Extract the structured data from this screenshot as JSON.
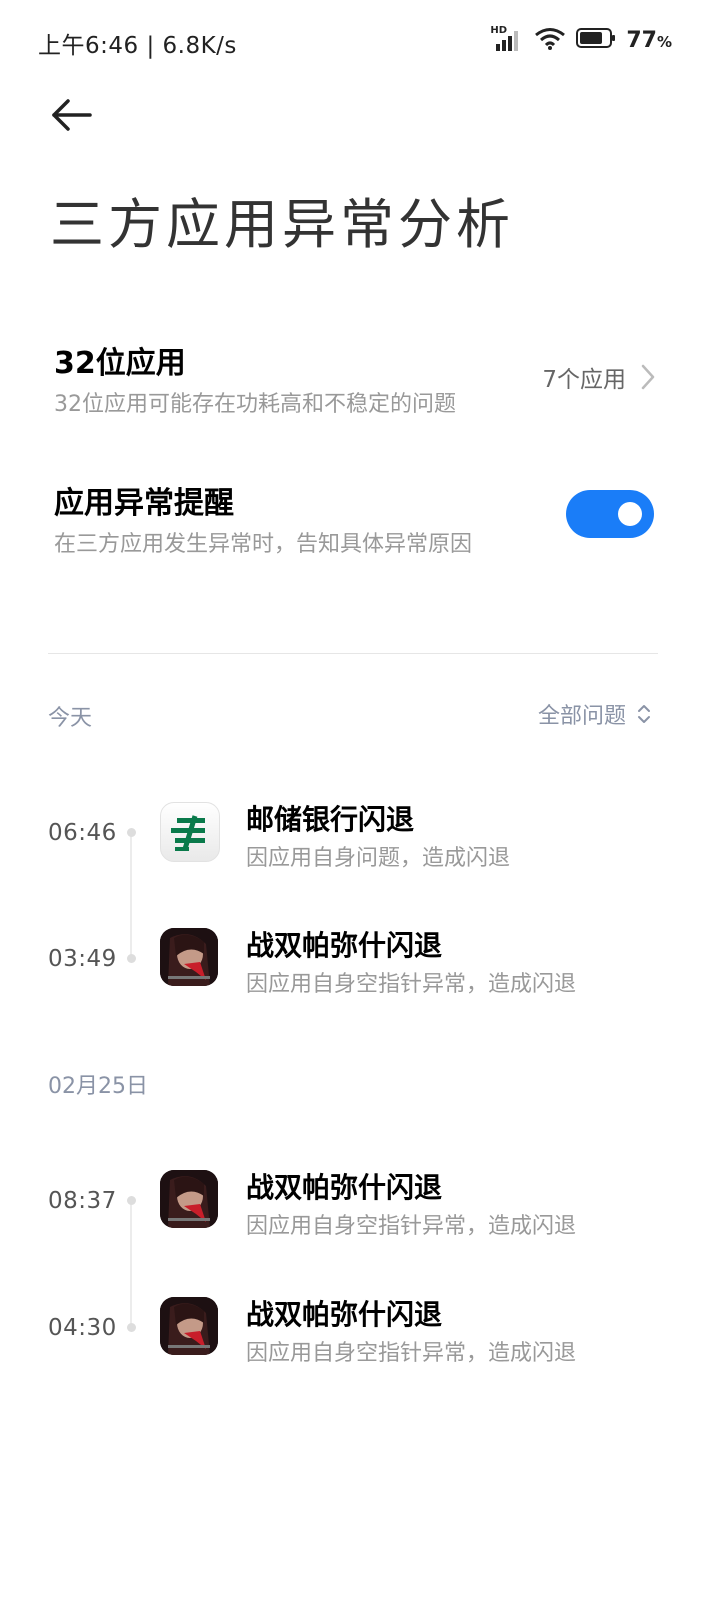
{
  "status_bar": {
    "time_speed": "上午6:46 | 6.8K/s",
    "network_badge": "HD",
    "battery_percent": "77",
    "battery_unit": "%",
    "battery_level": 0.77
  },
  "header": {
    "title": "三方应用异常分析"
  },
  "settings": {
    "bit32": {
      "title": "32位应用",
      "subtitle": "32位应用可能存在功耗高和不稳定的问题",
      "count": "7个应用"
    },
    "alert": {
      "title": "应用异常提醒",
      "subtitle": "在三方应用发生异常时，告知具体异常原因",
      "enabled": true
    }
  },
  "filter": {
    "label": "全部问题"
  },
  "groups": [
    {
      "date": "今天",
      "items": [
        {
          "time": "06:46",
          "title": "邮储银行闪退",
          "subtitle": "因应用自身问题，造成闪退",
          "icon": "postal-bank-icon"
        },
        {
          "time": "03:49",
          "title": "战双帕弥什闪退",
          "subtitle": "因应用自身空指针异常，造成闪退",
          "icon": "punishing-game-icon"
        }
      ]
    },
    {
      "date": "02月25日",
      "items": [
        {
          "time": "08:37",
          "title": "战双帕弥什闪退",
          "subtitle": "因应用自身空指针异常，造成闪退",
          "icon": "punishing-game-icon"
        },
        {
          "time": "04:30",
          "title": "战双帕弥什闪退",
          "subtitle": "因应用自身空指针异常，造成闪退",
          "icon": "punishing-game-icon"
        }
      ]
    }
  ],
  "colors": {
    "accent": "#1a7df8",
    "bank_green": "#0a7a4b"
  }
}
